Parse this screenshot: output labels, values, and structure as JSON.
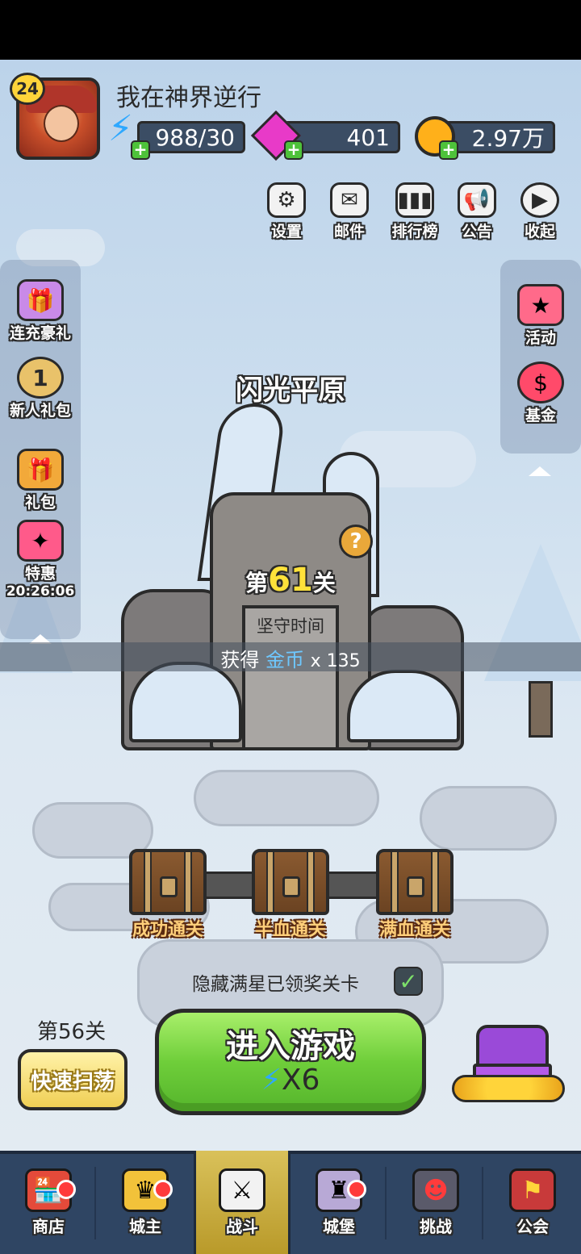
{
  "player": {
    "level": "24",
    "name": "我在神界逆行"
  },
  "resources": {
    "energy": "988/30",
    "gems": "401",
    "gold": "2.97万"
  },
  "toolbar": [
    {
      "label": "设置",
      "icon": "gear-icon"
    },
    {
      "label": "邮件",
      "icon": "mail-icon"
    },
    {
      "label": "排行榜",
      "icon": "ranking-icon"
    },
    {
      "label": "公告",
      "icon": "megaphone-icon"
    },
    {
      "label": "收起",
      "icon": "collapse-play-icon"
    }
  ],
  "left_menu": [
    {
      "label": "连充豪礼",
      "icon": "gift-box-icon"
    },
    {
      "label": "新人礼包",
      "icon": "star-badge-icon",
      "badge": "1"
    },
    {
      "label": "礼包",
      "icon": "gift-icon"
    },
    {
      "label": "特惠",
      "icon": "special-offer-chest-icon",
      "timer": "20:26:06"
    }
  ],
  "right_menu": [
    {
      "label": "活动",
      "icon": "activity-gift-icon"
    },
    {
      "label": "基金",
      "icon": "fund-bag-icon"
    }
  ],
  "stage": {
    "title": "闪光平原",
    "level_prefix": "第",
    "level_number": "61",
    "level_suffix": "关",
    "mode": "坚守时间",
    "reward_prefix": "获得",
    "reward_item": "金币",
    "reward_amount": "x 135"
  },
  "chests": [
    {
      "label": "成功通关"
    },
    {
      "label": "半血通关"
    },
    {
      "label": "满血通关"
    }
  ],
  "hide_option": {
    "label": "隐藏满星已领奖关卡",
    "checked": true
  },
  "sweep": {
    "level": "第56关",
    "button": "快速扫荡"
  },
  "enter": {
    "label": "进入游戏",
    "cost": "X6"
  },
  "nav": [
    {
      "label": "商店",
      "icon": "shop-icon",
      "dot": true
    },
    {
      "label": "城主",
      "icon": "crown-icon",
      "dot": true
    },
    {
      "label": "战斗",
      "icon": "crossed-swords-icon",
      "active": true
    },
    {
      "label": "城堡",
      "icon": "castle-icon",
      "dot": true
    },
    {
      "label": "挑战",
      "icon": "demon-icon"
    },
    {
      "label": "公会",
      "icon": "guild-banner-icon"
    }
  ],
  "colors": {
    "accent_green": "#6fce3a",
    "gold_text": "#ffe23a",
    "nav_bg": "#2f4563",
    "active_nav": "#d9c15a",
    "notification": "#ff3b3b"
  }
}
